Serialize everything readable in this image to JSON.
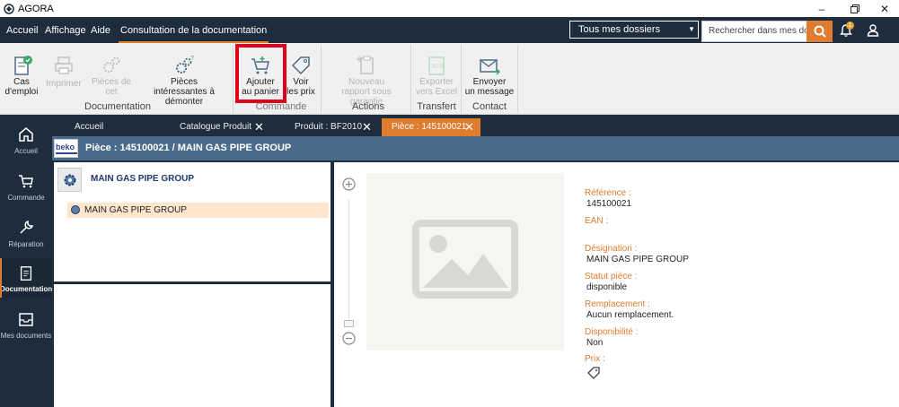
{
  "window": {
    "title": "AGORA"
  },
  "menu": {
    "items": [
      "Accueil",
      "Affichage",
      "Aide",
      "Consultation de la documentation"
    ],
    "dossier_select": "Tous mes dossiers",
    "search_placeholder": "Rechercher dans mes dossiers",
    "notification_count": "1"
  },
  "ribbon": {
    "buttons": {
      "cas_emploi": [
        "Cas",
        "d'emploi"
      ],
      "imprimer": [
        "Imprimer"
      ],
      "pieces_appareil": [
        "Pièces de",
        "cet appareil"
      ],
      "pieces_interessantes": [
        "Pièces",
        "intéressantes à démonter"
      ],
      "ajouter_panier": [
        "Ajouter",
        "au panier"
      ],
      "voir_prix": [
        "Voir",
        "les prix"
      ],
      "nouveau_rapport": [
        "Nouveau",
        "rapport sous garantie"
      ],
      "exporter_excel": [
        "Exporter",
        "vers Excel"
      ],
      "envoyer_message": [
        "Envoyer",
        "un message"
      ]
    },
    "groups": {
      "documentation": "Documentation",
      "commande": "Commande",
      "actions": "Actions",
      "transfert": "Transfert",
      "contact": "Contact"
    }
  },
  "leftnav": {
    "items": [
      "Accueil",
      "Commande",
      "Réparation",
      "Documentation",
      "Mes documents"
    ],
    "active": "Documentation"
  },
  "tabs": [
    {
      "label": "Accueil",
      "closable": false
    },
    {
      "label": "Catalogue Produit",
      "closable": true
    },
    {
      "label": "Produit : BF2010",
      "closable": true
    },
    {
      "label": "Pièce : 145100021",
      "closable": true,
      "active": true
    }
  ],
  "piece": {
    "brand": "beko",
    "title": "Pièce : 145100021  / MAIN GAS PIPE GROUP",
    "group_name": "MAIN GAS PIPE GROUP",
    "tree_item": "MAIN GAS PIPE GROUP"
  },
  "details": {
    "reference_label": "Référence :",
    "reference_value": "145100021",
    "ean_label": "EAN :",
    "ean_value": "",
    "designation_label": "Désignation :",
    "designation_value": "MAIN GAS PIPE GROUP",
    "statut_label": "Statut pièce :",
    "statut_value": "disponible",
    "remplacement_label": "Remplacement :",
    "remplacement_value": "Aucun remplacement.",
    "disponibilite_label": "Disponibilité :",
    "disponibilite_value": "Non",
    "prix_label": "Prix :"
  },
  "colors": {
    "nav_bg": "#1e2d3d",
    "accent": "#e07c2e",
    "header_blue": "#4a6b8a",
    "highlight_red": "#e0001a"
  }
}
